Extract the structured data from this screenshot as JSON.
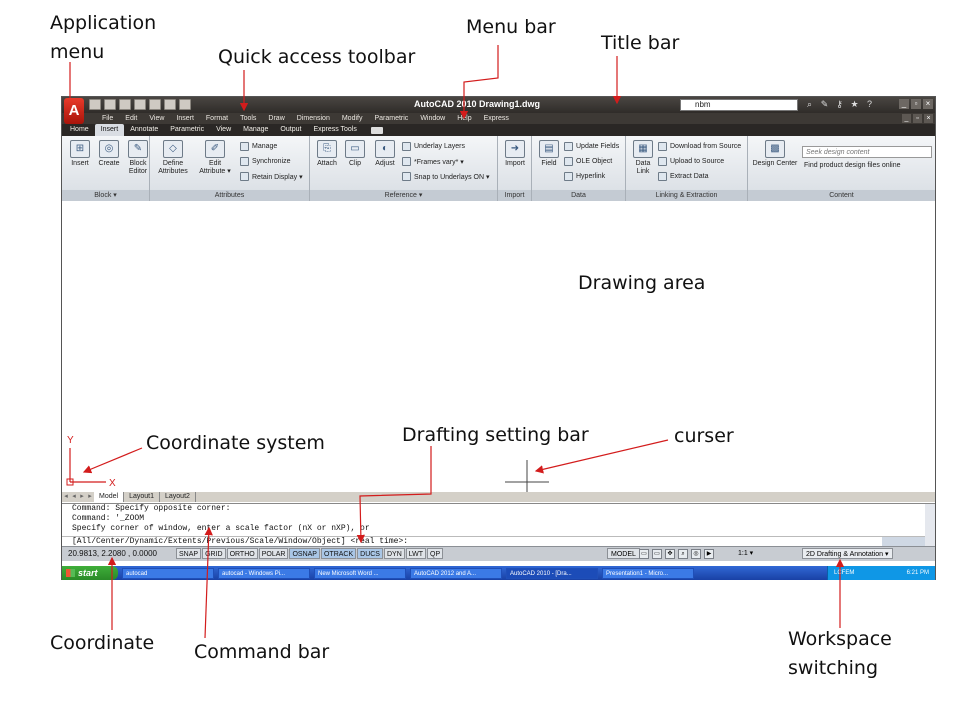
{
  "annotations": {
    "application_menu": "Application\nmenu",
    "menu_bar": "Menu bar",
    "quick_access_toolbar": "Quick access toolbar",
    "title_bar": "Title bar",
    "drawing_area": "Drawing area",
    "coordinate_system": "Coordinate system",
    "drafting_setting_bar": "Drafting setting bar",
    "curser": "curser",
    "coordinate": "Coordinate",
    "command_bar": "Command bar",
    "workspace_switching": "Workspace\nswitching"
  },
  "window": {
    "title": "AutoCAD 2010    Drawing1.dwg",
    "app_button_label": "A",
    "search_value": "nbm"
  },
  "menubar": [
    "File",
    "Edit",
    "View",
    "Insert",
    "Format",
    "Tools",
    "Draw",
    "Dimension",
    "Modify",
    "Parametric",
    "Window",
    "Help",
    "Express"
  ],
  "ribbon_tabs": [
    "Home",
    "Insert",
    "Annotate",
    "Parametric",
    "View",
    "Manage",
    "Output",
    "Express Tools"
  ],
  "ribbon": {
    "block": {
      "label": "Block ▾",
      "buttons": [
        "Insert",
        "Create",
        "Block\nEditor"
      ]
    },
    "attributes": {
      "label": "Attributes",
      "large": [
        "Define\nAttributes",
        "Edit\nAttribute ▾"
      ],
      "small": [
        "Manage",
        "Synchronize",
        "Retain Display ▾"
      ]
    },
    "reference": {
      "label": "Reference ▾",
      "large": [
        "Attach",
        "Clip",
        "Adjust"
      ],
      "small": [
        "Underlay Layers",
        "*Frames vary* ▾",
        "Snap to Underlays ON ▾"
      ]
    },
    "import": {
      "label": "Import",
      "button": "Import"
    },
    "data": {
      "label": "Data",
      "large": "Field",
      "small": [
        "Update Fields",
        "OLE Object",
        "Hyperlink"
      ]
    },
    "linking": {
      "label": "Linking & Extraction",
      "large": "Data\nLink",
      "small": [
        "Download from Source",
        "Upload to Source",
        "Extract  Data"
      ]
    },
    "content": {
      "label": "Content",
      "large": "Design Center",
      "search_placeholder": "Seek design content",
      "find": "Find product design files online"
    }
  },
  "layout_tabs": [
    "Model",
    "Layout1",
    "Layout2"
  ],
  "axes": {
    "y": "Y",
    "x": "X"
  },
  "command_lines": [
    "Command: Specify opposite corner:",
    "Command: '_ZOOM",
    "Specify corner of window, enter a scale factor (nX or nXP), or",
    "[All/Center/Dynamic/Extents/Previous/Scale/Window/Object] <real time>:"
  ],
  "status": {
    "coordinates": "20.9813, 2.2080 , 0.0000",
    "toggles": [
      "SNAP",
      "GRID",
      "ORTHO",
      "POLAR",
      "OSNAP",
      "OTRACK",
      "DUCS",
      "DYN",
      "LWT",
      "QP"
    ],
    "model": "MODEL",
    "scale": "1:1 ▾",
    "workspace": "2D Drafting & Annotation ▾"
  },
  "taskbar": {
    "start": "start",
    "tasks": [
      "autocad",
      "autocad - Windows Pi...",
      "New Microsoft Word ...",
      "AutoCAD 2012 and A...",
      "AutoCAD 2010 - [Dra...",
      "Presentation1 - Micro..."
    ],
    "tray_label": "LCFEM",
    "clock": "6:21 PM"
  },
  "colors": {
    "annotation_arrow": "#d31c1c",
    "title_bar": "#3a3632",
    "taskbar": "#2456c8",
    "start": "#34a033"
  }
}
